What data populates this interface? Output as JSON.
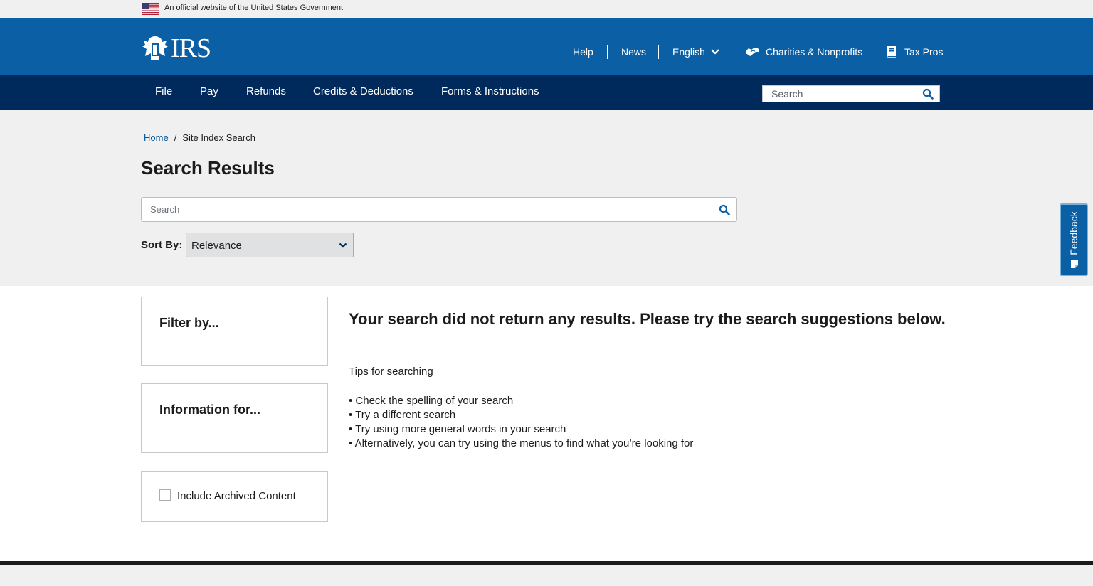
{
  "gov_banner": {
    "text": "An official website of the United States Government"
  },
  "header": {
    "logo_text": "IRS",
    "utility_links": {
      "help": "Help",
      "news": "News",
      "language": "English",
      "charities": "Charities & Nonprofits",
      "tax_pros": "Tax Pros"
    }
  },
  "mainnav": {
    "items": [
      "File",
      "Pay",
      "Refunds",
      "Credits & Deductions",
      "Forms & Instructions"
    ],
    "search_placeholder": "Search"
  },
  "breadcrumb": {
    "home": "Home",
    "separator": "/",
    "current": "Site Index Search"
  },
  "page": {
    "title": "Search Results",
    "search_placeholder": "Search",
    "sort_label": "Sort By:",
    "sort_value": "Relevance"
  },
  "feedback": {
    "label": "Feedback"
  },
  "sidebar": {
    "filter_title": "Filter by...",
    "info_title": "Information for...",
    "archive_label": "Include Archived Content"
  },
  "results": {
    "message": "Your search did not return any results. Please try the search suggestions below.",
    "tips_title": "Tips for searching",
    "tips": [
      "• Check the spelling of your search",
      "• Try a different search",
      "• Try using more general words in your search",
      "• Alternatively, you can try using the menus to find what you’re looking for"
    ]
  },
  "colors": {
    "header_blue": "#0b5fa5",
    "nav_navy": "#00295c",
    "link_blue": "#00599c",
    "gray_bg": "#f0f0f0"
  }
}
